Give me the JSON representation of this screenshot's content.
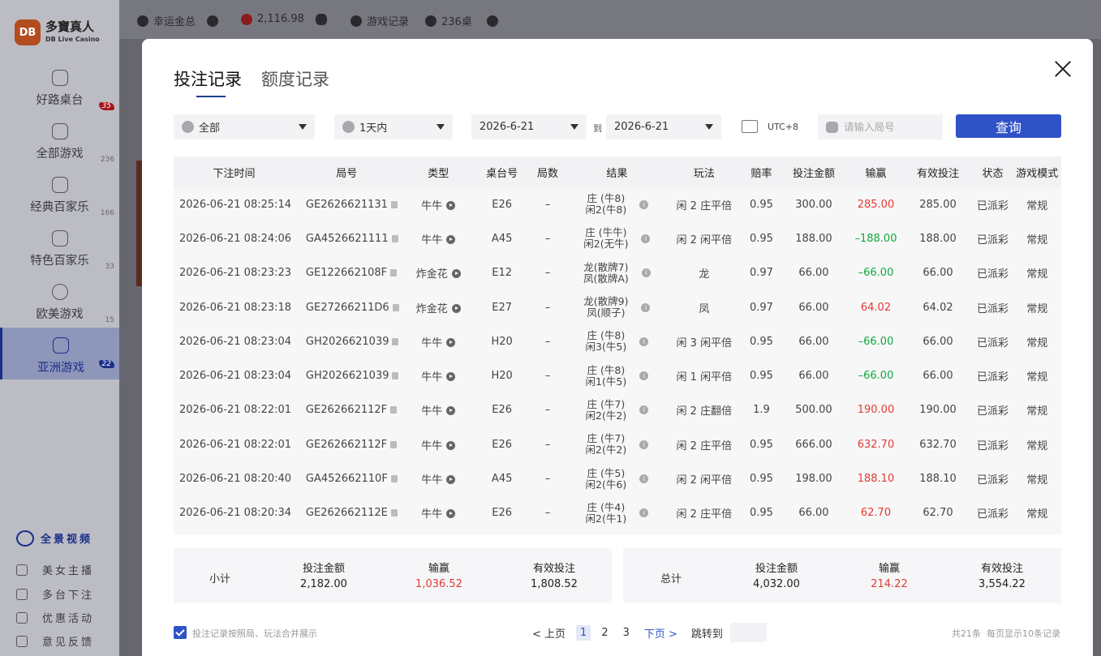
{
  "brand": {
    "mark": "DB",
    "name_cn": "多寶真人",
    "name_en": "DB Live Casino"
  },
  "sidebar": {
    "items": [
      {
        "label": "好路桌台",
        "count": "35"
      },
      {
        "label": "全部游戏",
        "count": "236"
      },
      {
        "label": "经典百家乐",
        "count": "166"
      },
      {
        "label": "特色百家乐",
        "count": "33"
      },
      {
        "label": "欧美游戏",
        "count": "15"
      },
      {
        "label": "亚洲游戏",
        "count": "22"
      }
    ],
    "panorama": "全景视频",
    "bottom": [
      "美女主播",
      "多台下注",
      "优惠活动",
      "意见反馈"
    ]
  },
  "topbar": {
    "user": "幸运金总",
    "balance": "2,116.98",
    "records": "游戏记录",
    "tables": "236桌"
  },
  "modal": {
    "tabs": [
      "投注记录",
      "额度记录"
    ],
    "filters": {
      "type": "全部",
      "period": "1天内",
      "date_from": "2026-6-21",
      "to": "到",
      "date_to": "2026-6-21",
      "timezone": "UTC+8",
      "search_placeholder": "请输入局号",
      "query": "查询"
    },
    "columns": [
      "下注时间",
      "局号",
      "类型",
      "桌台号",
      "局数",
      "结果",
      "玩法",
      "赔率",
      "投注金额",
      "输赢",
      "有效投注",
      "状态",
      "游戏模式"
    ],
    "rows": [
      {
        "time": "2026-06-21 08:25:14",
        "id": "GE2626621131",
        "type": "牛牛",
        "table": "E26",
        "round": "–",
        "r1": "庄 (牛8)",
        "r2": "闲2(牛8)",
        "play": "闲 2 庄平倍",
        "odds": "0.95",
        "bet": "300.00",
        "wl": "285.00",
        "wl_class": "win",
        "valid": "285.00",
        "status": "已派彩",
        "mode": "常规"
      },
      {
        "time": "2026-06-21 08:24:06",
        "id": "GA4526621111",
        "type": "牛牛",
        "table": "A45",
        "round": "–",
        "r1": "庄 (牛牛)",
        "r2": "闲2(无牛)",
        "play": "闲 2 闲平倍",
        "odds": "0.95",
        "bet": "188.00",
        "wl": "–188.00",
        "wl_class": "lose",
        "valid": "188.00",
        "status": "已派彩",
        "mode": "常规"
      },
      {
        "time": "2026-06-21 08:23:23",
        "id": "GE122662108F",
        "type": "炸金花",
        "table": "E12",
        "round": "–",
        "r1": "龙(散牌7)",
        "r2": "凤(散牌A)",
        "play": "龙",
        "odds": "0.97",
        "bet": "66.00",
        "wl": "–66.00",
        "wl_class": "lose",
        "valid": "66.00",
        "status": "已派彩",
        "mode": "常规"
      },
      {
        "time": "2026-06-21 08:23:18",
        "id": "GE27266211D6",
        "type": "炸金花",
        "table": "E27",
        "round": "–",
        "r1": "龙(散牌9)",
        "r2": "凤(顺子)",
        "play": "凤",
        "odds": "0.97",
        "bet": "66.00",
        "wl": "64.02",
        "wl_class": "win",
        "valid": "64.02",
        "status": "已派彩",
        "mode": "常规"
      },
      {
        "time": "2026-06-21 08:23:04",
        "id": "GH2026621039",
        "type": "牛牛",
        "table": "H20",
        "round": "–",
        "r1": "庄 (牛8)",
        "r2": "闲3(牛5)",
        "play": "闲 3 闲平倍",
        "odds": "0.95",
        "bet": "66.00",
        "wl": "–66.00",
        "wl_class": "lose",
        "valid": "66.00",
        "status": "已派彩",
        "mode": "常规"
      },
      {
        "time": "2026-06-21 08:23:04",
        "id": "GH2026621039",
        "type": "牛牛",
        "table": "H20",
        "round": "–",
        "r1": "庄 (牛8)",
        "r2": "闲1(牛5)",
        "play": "闲 1 闲平倍",
        "odds": "0.95",
        "bet": "66.00",
        "wl": "–66.00",
        "wl_class": "lose",
        "valid": "66.00",
        "status": "已派彩",
        "mode": "常规"
      },
      {
        "time": "2026-06-21 08:22:01",
        "id": "GE262662112F",
        "type": "牛牛",
        "table": "E26",
        "round": "–",
        "r1": "庄 (牛7)",
        "r2": "闲2(牛2)",
        "play": "闲 2 庄翻倍",
        "odds": "1.9",
        "bet": "500.00",
        "wl": "190.00",
        "wl_class": "win",
        "valid": "190.00",
        "status": "已派彩",
        "mode": "常规"
      },
      {
        "time": "2026-06-21 08:22:01",
        "id": "GE262662112F",
        "type": "牛牛",
        "table": "E26",
        "round": "–",
        "r1": "庄 (牛7)",
        "r2": "闲2(牛2)",
        "play": "闲 2 庄平倍",
        "odds": "0.95",
        "bet": "666.00",
        "wl": "632.70",
        "wl_class": "win",
        "valid": "632.70",
        "status": "已派彩",
        "mode": "常规"
      },
      {
        "time": "2026-06-21 08:20:40",
        "id": "GA452662110F",
        "type": "牛牛",
        "table": "A45",
        "round": "–",
        "r1": "庄 (牛5)",
        "r2": "闲2(牛6)",
        "play": "闲 2 闲平倍",
        "odds": "0.95",
        "bet": "198.00",
        "wl": "188.10",
        "wl_class": "win",
        "valid": "188.10",
        "status": "已派彩",
        "mode": "常规"
      },
      {
        "time": "2026-06-21 08:20:34",
        "id": "GE262662112E",
        "type": "牛牛",
        "table": "E26",
        "round": "–",
        "r1": "庄 (牛4)",
        "r2": "闲2(牛1)",
        "play": "闲 2 庄平倍",
        "odds": "0.95",
        "bet": "66.00",
        "wl": "62.70",
        "wl_class": "win",
        "valid": "62.70",
        "status": "已派彩",
        "mode": "常规"
      }
    ],
    "subtotal": {
      "label": "小计",
      "bet_label": "投注金额",
      "bet": "2,182.00",
      "wl_label": "输赢",
      "wl": "1,036.52",
      "valid_label": "有效投注",
      "valid": "1,808.52"
    },
    "total": {
      "label": "总计",
      "bet_label": "投注金额",
      "bet": "4,032.00",
      "wl_label": "输赢",
      "wl": "214.22",
      "valid_label": "有效投注",
      "valid": "3,554.22"
    },
    "footer": {
      "merge_text": "投注记录按照局、玩法合并展示",
      "prev": "< 上页",
      "pages": [
        "1",
        "2",
        "3"
      ],
      "next": "下页 >",
      "jump": "跳转到",
      "total_records": "共21条",
      "per_page": "每页显示10条记录"
    }
  },
  "colors": {
    "accent": "#2f53c7",
    "win": "#e23a32",
    "lose": "#11a93b"
  }
}
